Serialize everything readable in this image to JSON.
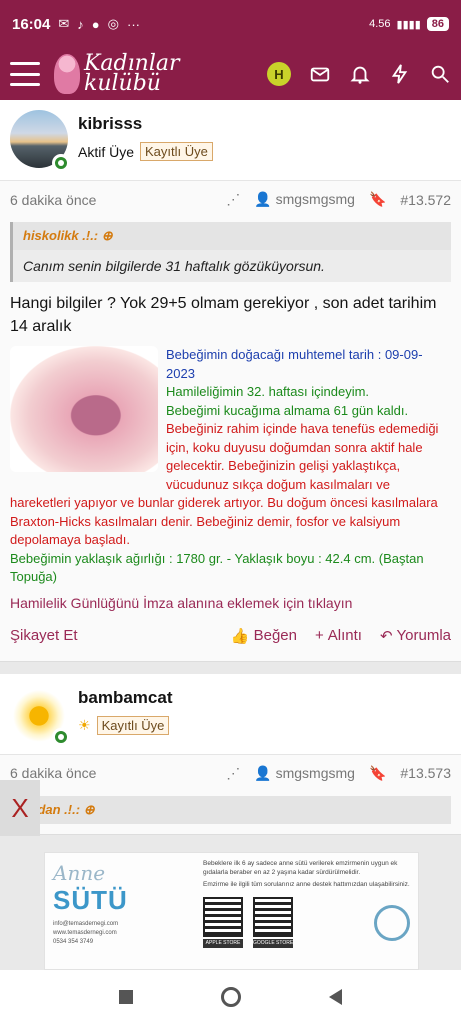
{
  "status_bar": {
    "time": "16:04",
    "battery": "86",
    "net_speed": "4.56"
  },
  "app": {
    "logo_line1": "Kadınlar",
    "logo_line2": "kulübü",
    "user_initial": "H"
  },
  "posts": [
    {
      "username": "kibrisss",
      "role": "Aktif Üye",
      "badge": "Kayıtlı Üye",
      "time": "6 dakika önce",
      "author_tag": "smgsmgsmg",
      "post_number": "#13.572",
      "quote_author": "hiskolikk .!.:",
      "quote_text": "Canım senin bilgilerde 31 haftalık gözüküyorsun.",
      "message": "Hangi bilgiler ? Yok 29+5 olmam gerekiyor , son adet tarihim 14 aralık",
      "signature": {
        "due_date": "Bebeğimin doğacağı muhtemel tarih : 09-09-2023",
        "week": "Hamileliğimin 32. haftası içindeyim.",
        "days_left": "Bebeğimi kucağıma almama 61 gün kaldı.",
        "info": "Bebeğiniz rahim içinde hava tenefüs edemediği için, koku duyusu doğumdan sonra aktif hale gelecektir. Bebeğinizin gelişi yaklaştıkça, vücudunuz sıkça doğum kasılmaları ve hareketleri yapıyor ve bunlar giderek artıyor. Bu doğum öncesi kasılmalara Braxton-Hicks kasılmaları denir. Bebeğiniz demir, fosfor ve kalsiyum depolamaya başladı.",
        "weight": "Bebeğimin yaklaşık ağırlığı : 1780 gr. - Yaklaşık boyu : 42.4 cm. (Baştan Topuğa)",
        "link": "Hamilelik Günlüğünü İmza alanına eklemek için tıklayın"
      },
      "actions": {
        "report": "Şikayet Et",
        "like": "Beğen",
        "quote": "Alıntı",
        "reply": "Yorumla"
      }
    },
    {
      "username": "bambamcat",
      "badge": "Kayıtlı Üye",
      "time": "6 dakika önce",
      "author_tag": "smgsmgsmg",
      "post_number": "#13.573",
      "quote_author": "vadan .!.:"
    }
  ],
  "ad": {
    "close": "X",
    "title_anne": "Anne",
    "title_sutu": "SÜTÜ",
    "contact": "info@temasdernegi.com\nwww.temasdernegi.com\n0534 354 3749",
    "text": "Bebeklere ilk 6 ay sadece anne sütü verilerek emzirmenin uygun ek gıdalarla beraber en az 2 yaşına kadar sürdürülmelidir.",
    "text2": "Emzirme ile ilgili tüm sorularınız anne destek hattımızdan ulaşabilirsiniz.",
    "store1": "APPLE STORE",
    "store2": "GOOGLE STORE"
  },
  "colors": {
    "brand": "#8a1d47",
    "accent_link": "#9a2a56",
    "blue_text": "#1d3fae",
    "green_text": "#1c8a1c",
    "red_text": "#d11a1a"
  }
}
